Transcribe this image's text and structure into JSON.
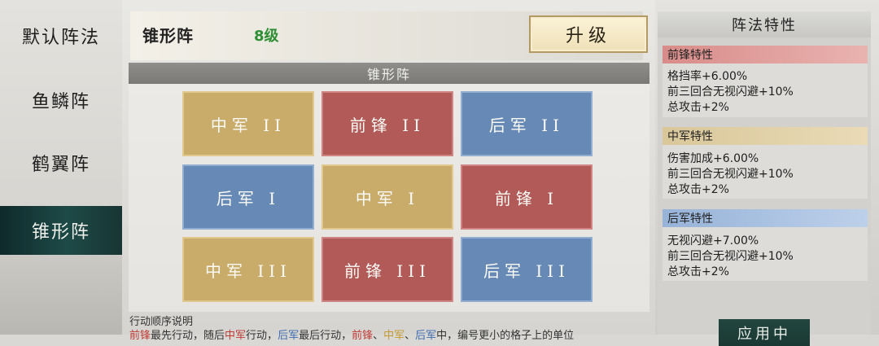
{
  "sidebar": {
    "items": [
      {
        "label": "默认阵法"
      },
      {
        "label": "鱼鳞阵"
      },
      {
        "label": "鹤翼阵"
      },
      {
        "label": "锥形阵"
      }
    ],
    "active_index": 3
  },
  "header": {
    "formation_name": "锥形阵",
    "level": "8级",
    "upgrade_label": "升级"
  },
  "grid": {
    "title": "锥形阵",
    "cells": [
      {
        "label": "中军 II",
        "type": "middle"
      },
      {
        "label": "前锋 II",
        "type": "front"
      },
      {
        "label": "后军 II",
        "type": "rear"
      },
      {
        "label": "后军 I",
        "type": "rear"
      },
      {
        "label": "中军 I",
        "type": "middle"
      },
      {
        "label": "前锋 I",
        "type": "front"
      },
      {
        "label": "中军 III",
        "type": "middle"
      },
      {
        "label": "前锋 III",
        "type": "front"
      },
      {
        "label": "后军 III",
        "type": "rear"
      }
    ]
  },
  "order": {
    "title": "行动顺序说明",
    "part1": "前锋",
    "part2": "最先行动，随后",
    "part3": "中军",
    "part4": "行动，",
    "part5": "后军",
    "part6": "最后行动，",
    "part7": "前锋",
    "part8": "、",
    "part9": "中军",
    "part10": "、",
    "part11": "后军",
    "part12": "中，编号更小的格子上的单位"
  },
  "traits": {
    "title": "阵法特性",
    "front": {
      "head": "前锋特性",
      "lines": [
        "格挡率+6.00%",
        "前三回合无视闪避+10%",
        "总攻击+2%"
      ]
    },
    "middle": {
      "head": "中军特性",
      "lines": [
        "伤害加成+6.00%",
        "前三回合无视闪避+10%",
        "总攻击+2%"
      ]
    },
    "rear": {
      "head": "后军特性",
      "lines": [
        "无视闪避+7.00%",
        "前三回合无视闪避+10%",
        "总攻击+2%"
      ]
    },
    "apply_label": "应用中"
  },
  "colors": {
    "middle": "#c9ab6a",
    "front": "#b15a58",
    "rear": "#6689b6",
    "active_sidebar": "#173533",
    "level": "#2e8f34"
  }
}
